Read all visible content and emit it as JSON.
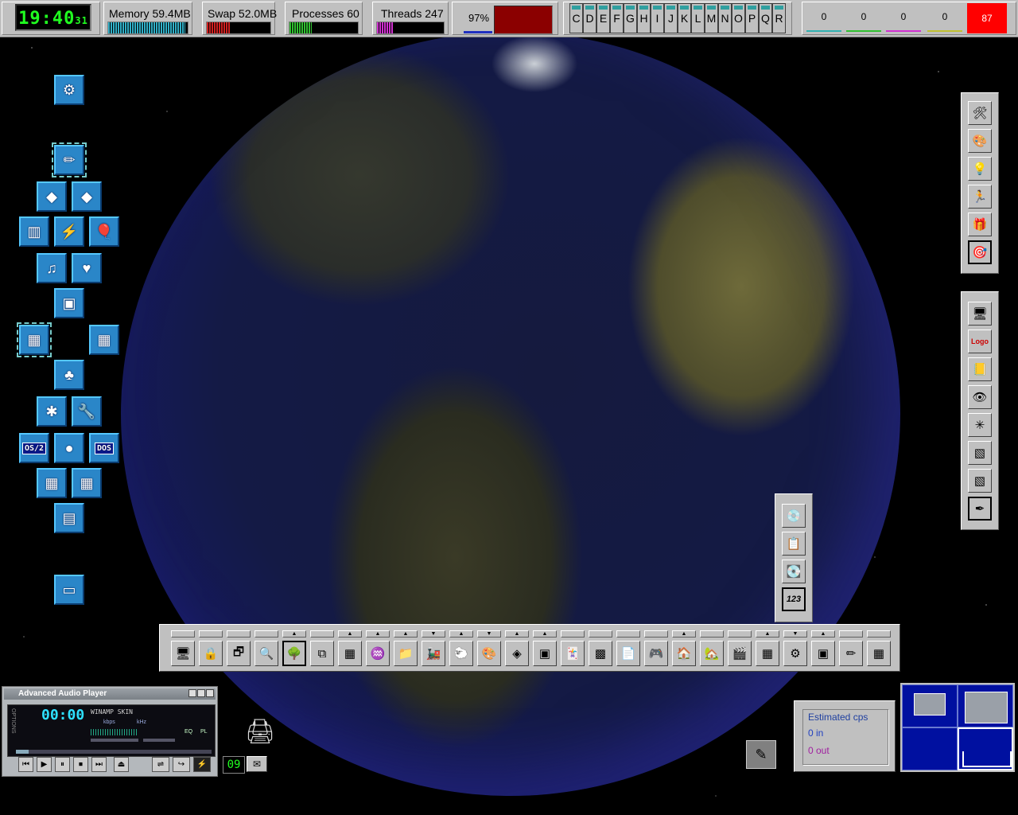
{
  "top": {
    "clock": {
      "hm": "19:40",
      "sec": "31"
    },
    "memory": {
      "label": "Memory 59.4MB",
      "fill": 0.97,
      "color": "#30b0c8"
    },
    "swap": {
      "label": "Swap 52.0MB",
      "fill": 0.38,
      "color": "#d02020"
    },
    "processes": {
      "label": "Processes 60",
      "fill": 0.32,
      "color": "#30c030"
    },
    "threads": {
      "label": "Threads 247",
      "fill": 0.24,
      "color": "#d030d0"
    },
    "cpu": {
      "label": "97%",
      "color": "#8b0000"
    },
    "drives": [
      "C",
      "D",
      "E",
      "F",
      "G",
      "H",
      "I",
      "J",
      "K",
      "L",
      "M",
      "N",
      "O",
      "P",
      "Q",
      "R"
    ],
    "net": [
      {
        "value": "0",
        "color": "#30b0b0"
      },
      {
        "value": "0",
        "color": "#30c030"
      },
      {
        "value": "0",
        "color": "#d030d0"
      },
      {
        "value": "0",
        "color": "#c0c030"
      },
      {
        "value": "87",
        "color": "#ff0000"
      }
    ]
  },
  "desktop_icons": [
    {
      "name": "launcher-icon",
      "glyph": "⚙"
    },
    {
      "name": "pencil-icon",
      "glyph": "✏"
    },
    {
      "name": "warning-icon-1",
      "glyph": "◆"
    },
    {
      "name": "warning-icon-2",
      "glyph": "◆"
    },
    {
      "name": "keyboard-icon",
      "glyph": "▥"
    },
    {
      "name": "network-computer-icon",
      "glyph": "⚡"
    },
    {
      "name": "balloon-icon",
      "glyph": "🎈"
    },
    {
      "name": "music-note-icon",
      "glyph": "♫"
    },
    {
      "name": "cards-game-icon",
      "glyph": "♥"
    },
    {
      "name": "monitor-icon",
      "glyph": "▣"
    },
    {
      "name": "system-monitor-icon-1",
      "glyph": "▦"
    },
    {
      "name": "system-monitor-icon-2",
      "glyph": "▦"
    },
    {
      "name": "tree-icon",
      "glyph": "♣"
    },
    {
      "name": "bug-icon",
      "glyph": "✱"
    },
    {
      "name": "wrench-icon",
      "glyph": "🔧"
    },
    {
      "name": "os2-icon",
      "text": "OS/2"
    },
    {
      "name": "apple-icon",
      "glyph": "●"
    },
    {
      "name": "dos-icon",
      "text": "DOS"
    },
    {
      "name": "window-grid-icon-1",
      "glyph": "▦"
    },
    {
      "name": "window-grid-icon-2",
      "glyph": "▦"
    },
    {
      "name": "drawer-icon",
      "glyph": "▤"
    },
    {
      "name": "devices-icon",
      "glyph": "▭"
    }
  ],
  "right_bar_1": [
    "🛠",
    "🎨",
    "💡",
    "🏃",
    "🎁",
    "🎯"
  ],
  "right_bar_2": [
    "🖥",
    "Logo",
    "📒",
    "👁",
    "✳",
    "▧",
    "▧",
    "✒"
  ],
  "mid_bar": [
    "💿",
    "📋",
    "💽",
    "123"
  ],
  "launch_bar": {
    "items": [
      "🖥",
      "🔒",
      "🗗",
      "🔍",
      "🌳",
      "⧉",
      "▦",
      "♒",
      "📁",
      "🚂",
      "🐑",
      "🎨",
      "◈",
      "▣",
      "🃏",
      "▩",
      "📄",
      "🎮",
      "🏠",
      "🏡",
      "🎬",
      "▦",
      "⚙",
      "▣",
      "✏",
      "▦"
    ],
    "arrows": [
      "",
      "",
      "",
      "",
      "▲",
      "",
      "▲",
      "▲",
      "▲",
      "▼",
      "▲",
      "▼",
      "▲",
      "▲",
      "",
      "",
      "",
      "",
      "▲",
      "",
      "",
      "▲",
      "▼",
      "▲",
      "",
      ""
    ]
  },
  "player": {
    "title": "Advanced Audio Player",
    "time": "00:00",
    "skin": "WINAMP SKIN",
    "kbps": "kbps",
    "khz": "kHz",
    "eq": "EQ",
    "pl": "PL",
    "side": "OPTIONS",
    "controls": [
      "⏮",
      "▶",
      "⏸",
      "⏹",
      "⏭",
      "⏏"
    ]
  },
  "counter": "09",
  "cps": {
    "title": "Estimated cps",
    "in": "0 in",
    "out": "0 out"
  }
}
